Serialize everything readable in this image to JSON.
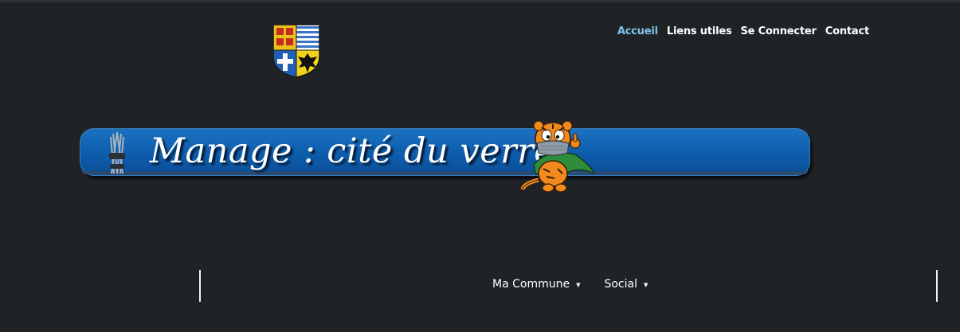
{
  "site": {
    "banner_title": "Manage : cité du verre"
  },
  "topnav": {
    "items": [
      {
        "label": "Accueil",
        "active": true
      },
      {
        "label": "Liens utiles",
        "active": false
      },
      {
        "label": "Se Connecter",
        "active": false
      },
      {
        "label": "Contact",
        "active": false
      }
    ]
  },
  "mainmenu": {
    "items": [
      {
        "label": "Ma Commune",
        "caret": "▼"
      },
      {
        "label": "Social",
        "caret": "▼"
      }
    ]
  },
  "icons": {
    "logo": "coat-of-arms-icon",
    "banner_left": "glass-tools-icon",
    "mascot": "tiger-mascot-icon",
    "dropdown": "caret-down-icon"
  },
  "colors": {
    "background": "#202326",
    "active_link": "#7fc4ec",
    "banner_blue": "#0d5aaa",
    "text": "#ffffff"
  }
}
